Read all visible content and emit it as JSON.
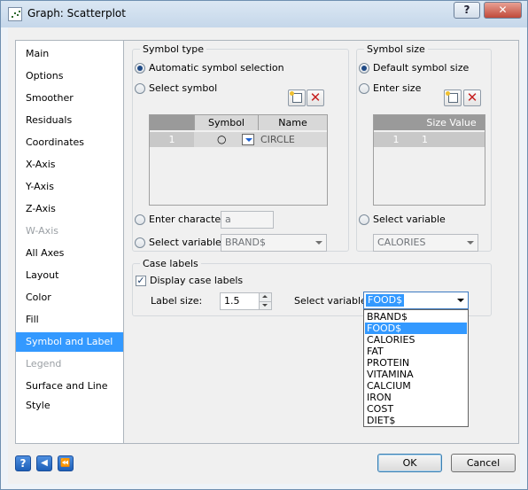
{
  "window": {
    "title": "Graph: Scatterplot"
  },
  "titlebar": {
    "help_label": "?",
    "close_label": "✕"
  },
  "nav": {
    "items": [
      {
        "label": "Main",
        "state": "normal"
      },
      {
        "label": "Options",
        "state": "normal"
      },
      {
        "label": "Smoother",
        "state": "normal"
      },
      {
        "label": "Residuals",
        "state": "normal"
      },
      {
        "label": "Coordinates",
        "state": "normal"
      },
      {
        "label": "X-Axis",
        "state": "normal"
      },
      {
        "label": "Y-Axis",
        "state": "normal"
      },
      {
        "label": "Z-Axis",
        "state": "normal"
      },
      {
        "label": "W-Axis",
        "state": "disabled"
      },
      {
        "label": "All Axes",
        "state": "normal"
      },
      {
        "label": "Layout",
        "state": "normal"
      },
      {
        "label": "Color",
        "state": "normal"
      },
      {
        "label": "Fill",
        "state": "normal"
      },
      {
        "label": "Symbol and Label",
        "state": "selected"
      },
      {
        "label": "Legend",
        "state": "disabled"
      },
      {
        "label": "Surface and Line Style",
        "state": "normal"
      }
    ]
  },
  "symbol_type": {
    "title": "Symbol type",
    "auto_label": "Automatic symbol selection",
    "select_label": "Select symbol",
    "table": {
      "col_symbol": "Symbol",
      "col_name": "Name",
      "rows": [
        {
          "index": "1",
          "symbol_glyph": "○",
          "name": "CIRCLE"
        }
      ]
    },
    "enter_char_label": "Enter character",
    "enter_char_value": "a",
    "select_var_label": "Select variable",
    "select_var_value": "BRAND$"
  },
  "symbol_size": {
    "title": "Symbol size",
    "default_label": "Default symbol size",
    "enter_label": "Enter size",
    "table": {
      "col_size": "Size Value",
      "rows": [
        {
          "index": "1",
          "value": "1"
        }
      ]
    },
    "select_var_label": "Select variable",
    "select_var_value": "CALORIES"
  },
  "case_labels": {
    "title": "Case labels",
    "display_label": "Display case labels",
    "display_checked": "✓",
    "label_size_label": "Label size:",
    "label_size_value": "1.5",
    "select_var_label": "Select variable:",
    "select_var_value": "FOOD$",
    "options": [
      "BRAND$",
      "FOOD$",
      "CALORIES",
      "FAT",
      "PROTEIN",
      "VITAMINA",
      "CALCIUM",
      "IRON",
      "COST",
      "DIET$"
    ],
    "highlighted": "FOOD$"
  },
  "footer": {
    "ok_label": "OK",
    "cancel_label": "Cancel",
    "help_icon_glyph": "?",
    "back_icon_glyph": "◀",
    "first_icon_glyph": "⏪"
  },
  "colors": {
    "selection": "#3399ff",
    "titlebar": "#c5d7ea",
    "close": "#c0493a"
  }
}
